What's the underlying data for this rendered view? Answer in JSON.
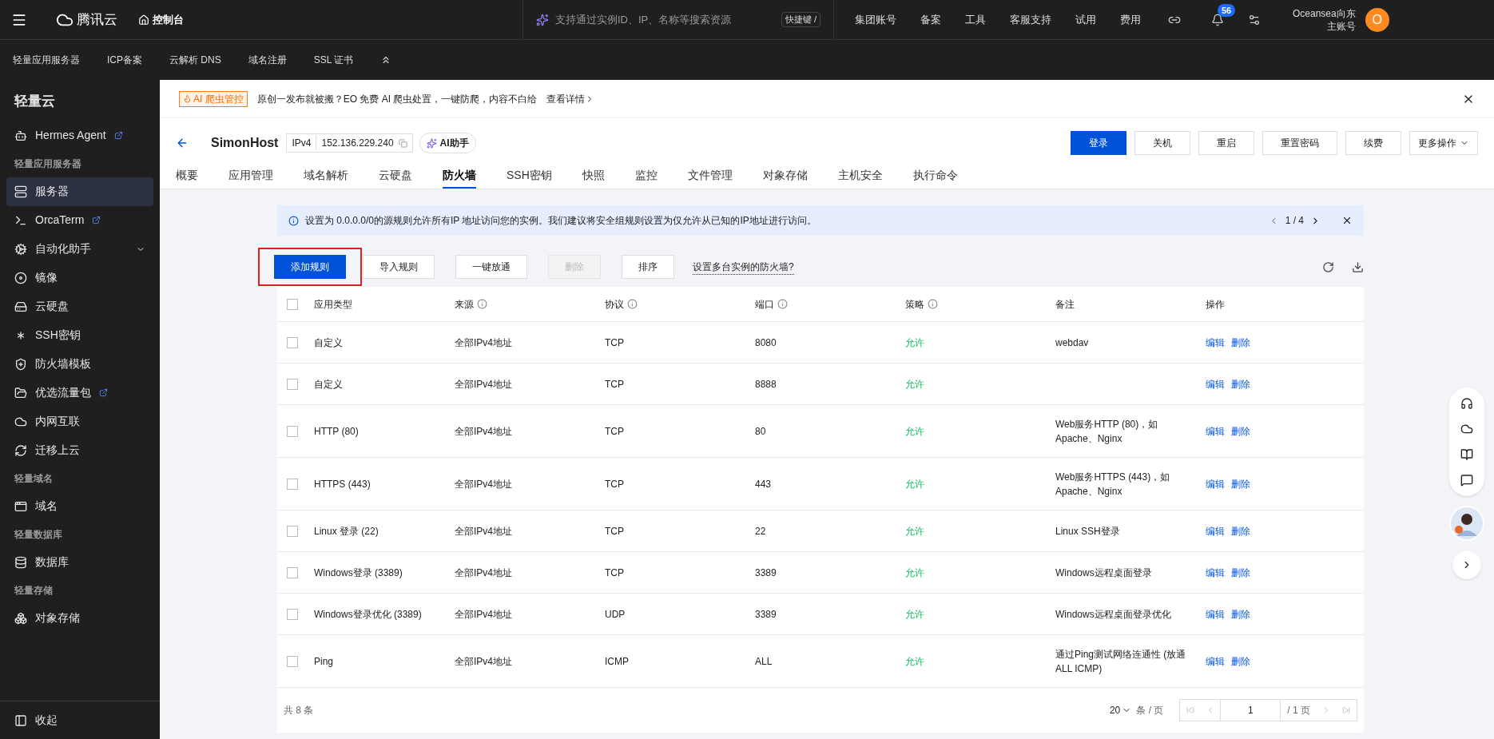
{
  "topbar": {
    "logo": "腾讯云",
    "console": "控制台",
    "search": {
      "placeholder": "支持通过实例ID、IP、名称等搜索资源"
    },
    "shortcut": "快捷键 /",
    "links": [
      "集团账号",
      "备案",
      "工具",
      "客服支持",
      "试用",
      "费用"
    ],
    "notifications": "56",
    "user": {
      "name": "Oceansea向东",
      "role": "主账号",
      "avatar": "O"
    }
  },
  "subnav": [
    "轻量应用服务器",
    "ICP备案",
    "云解析 DNS",
    "域名注册",
    "SSL 证书"
  ],
  "sidebar": {
    "title": "轻量云",
    "items": [
      {
        "kind": "item",
        "label": "Hermes Agent",
        "external": true,
        "selected": false
      },
      {
        "kind": "header",
        "label": "轻量应用服务器"
      },
      {
        "kind": "item",
        "label": "服务器",
        "external": false,
        "selected": true
      },
      {
        "kind": "item",
        "label": "OrcaTerm",
        "external": true,
        "selected": false
      },
      {
        "kind": "item",
        "label": "自动化助手",
        "external": false,
        "selected": false,
        "expandable": true
      },
      {
        "kind": "item",
        "label": "镜像",
        "external": false,
        "selected": false
      },
      {
        "kind": "item",
        "label": "云硬盘",
        "external": false,
        "selected": false
      },
      {
        "kind": "item",
        "label": "SSH密钥",
        "external": false,
        "selected": false
      },
      {
        "kind": "item",
        "label": "防火墙模板",
        "external": false,
        "selected": false
      },
      {
        "kind": "item",
        "label": "优选流量包",
        "external": true,
        "selected": false
      },
      {
        "kind": "item",
        "label": "内网互联",
        "external": false,
        "selected": false
      },
      {
        "kind": "item",
        "label": "迁移上云",
        "external": false,
        "selected": false
      },
      {
        "kind": "header",
        "label": "轻量域名"
      },
      {
        "kind": "item",
        "label": "域名",
        "external": false,
        "selected": false
      },
      {
        "kind": "header",
        "label": "轻量数据库"
      },
      {
        "kind": "item",
        "label": "数据库",
        "external": false,
        "selected": false
      },
      {
        "kind": "header",
        "label": "轻量存储"
      },
      {
        "kind": "item",
        "label": "对象存储",
        "external": false,
        "selected": false
      }
    ],
    "collapse": "收起"
  },
  "banner": {
    "tag": "AI 爬虫管控",
    "text": "原创一发布就被搬？EO 免费 AI 爬虫处置，一键防爬，内容不白给",
    "link": "查看详情"
  },
  "instance": {
    "name": "SimonHost",
    "ip_type": "IPv4",
    "ip": "152.136.229.240",
    "assistant": "AI助手",
    "actions": [
      {
        "label": "登录",
        "primary": true
      },
      {
        "label": "关机",
        "primary": false
      },
      {
        "label": "重启",
        "primary": false
      },
      {
        "label": "重置密码",
        "primary": false
      },
      {
        "label": "续费",
        "primary": false
      }
    ],
    "more": "更多操作"
  },
  "tabs": [
    {
      "label": "概要",
      "selected": false
    },
    {
      "label": "应用管理",
      "selected": false
    },
    {
      "label": "域名解析",
      "selected": false
    },
    {
      "label": "云硬盘",
      "selected": false
    },
    {
      "label": "防火墙",
      "selected": true
    },
    {
      "label": "SSH密钥",
      "selected": false
    },
    {
      "label": "快照",
      "selected": false
    },
    {
      "label": "监控",
      "selected": false
    },
    {
      "label": "文件管理",
      "selected": false
    },
    {
      "label": "对象存储",
      "selected": false
    },
    {
      "label": "主机安全",
      "selected": false
    },
    {
      "label": "执行命令",
      "selected": false
    }
  ],
  "notice": {
    "text": "设置为 0.0.0.0/0的源规则允许所有IP 地址访问您的实例。我们建议将安全组规则设置为仅允许从已知的IP地址进行访问。",
    "pager": "1 / 4"
  },
  "toolbar": {
    "buttons": [
      {
        "label": "添加规则",
        "primary": true,
        "disabled": false,
        "highlighted": true
      },
      {
        "label": "导入规则",
        "primary": false,
        "disabled": false,
        "highlighted": false
      },
      {
        "label": "一键放通",
        "primary": false,
        "disabled": false,
        "highlighted": false
      },
      {
        "label": "删除",
        "primary": false,
        "disabled": true,
        "highlighted": false
      },
      {
        "label": "排序",
        "primary": false,
        "disabled": false,
        "highlighted": false
      }
    ],
    "help_link": "设置多台实例的防火墙?"
  },
  "table": {
    "select_all_checked": false,
    "columns": [
      {
        "label": "应用类型",
        "info": false
      },
      {
        "label": "来源",
        "info": true
      },
      {
        "label": "协议",
        "info": true
      },
      {
        "label": "端口",
        "info": true
      },
      {
        "label": "策略",
        "info": true
      },
      {
        "label": "备注",
        "info": false
      },
      {
        "label": "操作",
        "info": false
      }
    ],
    "rows": [
      {
        "checked": false,
        "type": "自定义",
        "source": "全部IPv4地址",
        "protocol": "TCP",
        "port": "8080",
        "policy": "允许",
        "note": "webdav",
        "actions": [
          "编辑",
          "删除"
        ]
      },
      {
        "checked": false,
        "type": "自定义",
        "source": "全部IPv4地址",
        "protocol": "TCP",
        "port": "8888",
        "policy": "允许",
        "actions": [
          "编辑",
          "删除"
        ]
      },
      {
        "checked": false,
        "type": "HTTP (80)",
        "source": "全部IPv4地址",
        "protocol": "TCP",
        "port": "80",
        "policy": "允许",
        "note": "Web服务HTTP (80)，如Apache、Nginx",
        "actions": [
          "编辑",
          "删除"
        ]
      },
      {
        "checked": false,
        "type": "HTTPS (443)",
        "source": "全部IPv4地址",
        "protocol": "TCP",
        "port": "443",
        "policy": "允许",
        "note": "Web服务HTTPS (443)，如Apache、Nginx",
        "actions": [
          "编辑",
          "删除"
        ]
      },
      {
        "checked": false,
        "type": "Linux 登录 (22)",
        "source": "全部IPv4地址",
        "protocol": "TCP",
        "port": "22",
        "policy": "允许",
        "note": "Linux SSH登录",
        "actions": [
          "编辑",
          "删除"
        ]
      },
      {
        "checked": false,
        "type": "Windows登录 (3389)",
        "source": "全部IPv4地址",
        "protocol": "TCP",
        "port": "3389",
        "policy": "允许",
        "note": "Windows远程桌面登录",
        "actions": [
          "编辑",
          "删除"
        ]
      },
      {
        "checked": false,
        "type": "Windows登录优化 (3389)",
        "source": "全部IPv4地址",
        "protocol": "UDP",
        "port": "3389",
        "policy": "允许",
        "note": "Windows远程桌面登录优化",
        "actions": [
          "编辑",
          "删除"
        ]
      },
      {
        "checked": false,
        "type": "Ping",
        "source": "全部IPv4地址",
        "protocol": "ICMP",
        "port": "ALL",
        "policy": "允许",
        "note": "通过Ping测试网络连通性 (放通ALL ICMP)",
        "actions": [
          "编辑",
          "删除"
        ]
      }
    ],
    "total": "共 8 条",
    "page_size": "20",
    "page_size_unit": "条 / 页",
    "page": "1",
    "page_total": "/ 1 页"
  }
}
